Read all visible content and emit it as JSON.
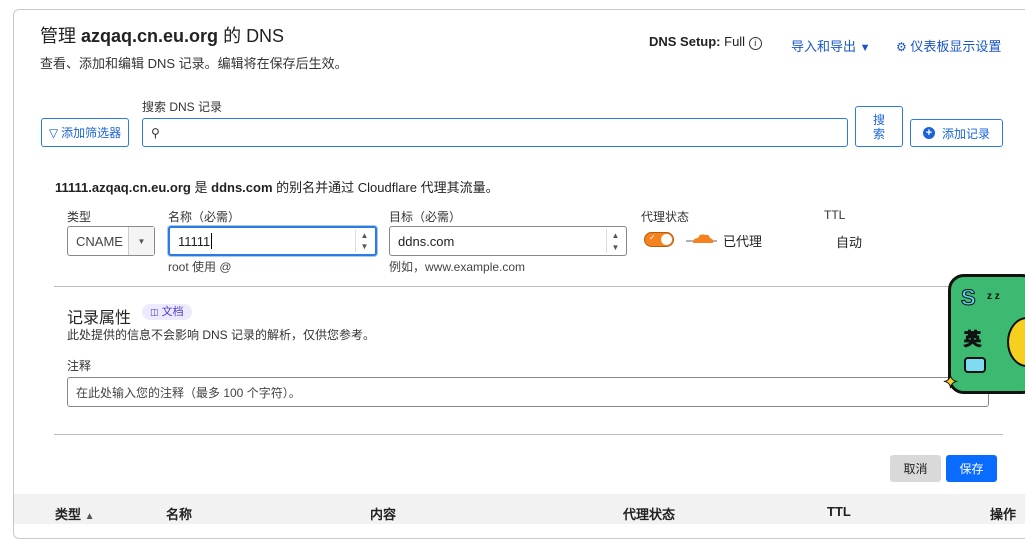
{
  "header": {
    "title_prefix": "管理",
    "domain": "azqaq.cn.eu.org",
    "title_suffix": "的 DNS",
    "subtitle": "查看、添加和编辑 DNS 记录。编辑将在保存后生效。",
    "setup_label": "DNS Setup:",
    "setup_value": "Full",
    "import_export": "导入和导出",
    "dashboard_settings": "仪表板显示设置"
  },
  "search": {
    "label": "搜索 DNS 记录",
    "placeholder": "",
    "filter_button": "添加筛选器",
    "search_button": "搜索",
    "add_record": "添加记录"
  },
  "form": {
    "info_name": "11111.azqaq.cn.eu.org",
    "info_is": "是",
    "info_target": "ddns.com",
    "info_rest": "的别名并通过 Cloudflare 代理其流量。",
    "type_label": "类型",
    "type_value": "CNAME",
    "name_label": "名称（必需）",
    "name_value": "11111",
    "name_hint": "root 使用 @",
    "target_label": "目标（必需）",
    "target_value": "ddns.com",
    "target_hint": "例如，www.example.com",
    "proxy_label": "代理状态",
    "proxy_on": true,
    "proxy_text": "已代理",
    "ttl_label": "TTL",
    "ttl_value": "自动"
  },
  "attrs": {
    "title": "记录属性",
    "docs": "文档",
    "desc": "此处提供的信息不会影响 DNS 记录的解析，仅供您参考。",
    "comment_label": "注释",
    "comment_placeholder": "在此处输入您的注释（最多 100 个字符）。"
  },
  "actions": {
    "cancel": "取消",
    "save": "保存"
  },
  "table": {
    "columns": [
      "类型",
      "名称",
      "内容",
      "代理状态",
      "TTL",
      "操作"
    ]
  },
  "sticker": {
    "letter": "S",
    "char": "英"
  },
  "colors": {
    "accent": "#0a6cff",
    "proxy": "#f6821f"
  }
}
